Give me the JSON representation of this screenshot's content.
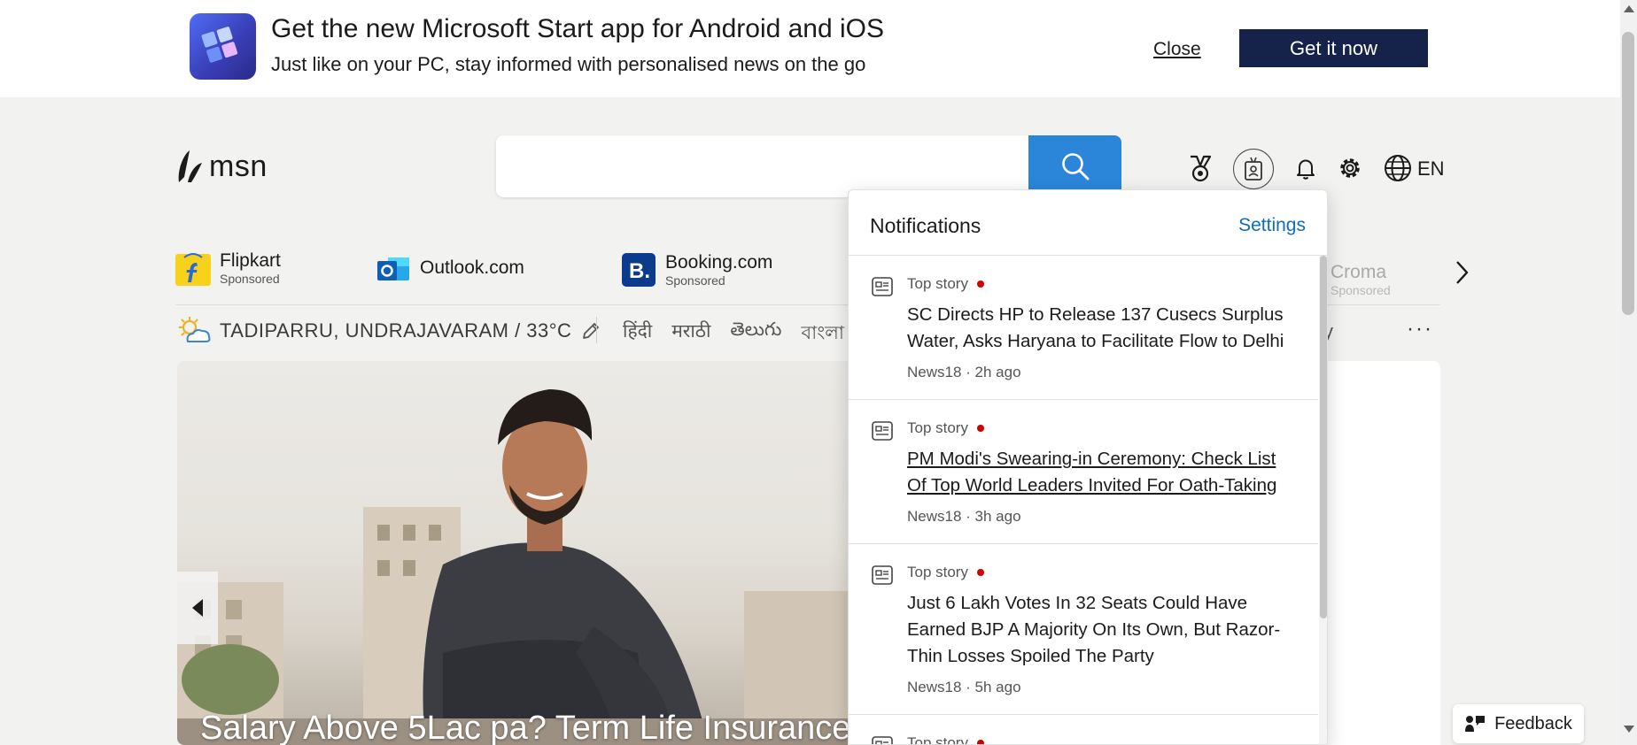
{
  "promo": {
    "title": "Get the new Microsoft Start app for Android and iOS",
    "subtitle": "Just like on your PC, stay informed with personalised news on the go",
    "close_label": "Close",
    "cta_label": "Get it now"
  },
  "header": {
    "logo_text": "msn",
    "search_placeholder": "",
    "language": "EN",
    "icons": [
      "rewards-icon",
      "profile-icon",
      "bell-icon",
      "gear-icon",
      "globe-icon",
      "search-icon"
    ]
  },
  "shortcuts": [
    {
      "label": "Flipkart",
      "sponsored": "Sponsored"
    },
    {
      "label": "Outlook.com",
      "sponsored": ""
    },
    {
      "label": "Booking.com",
      "sponsored": "Sponsored"
    },
    {
      "label": "Croma",
      "sponsored": "Sponsored"
    }
  ],
  "weather": {
    "location": "TADIPARRU, UNDRAJAVARAM / 33°C"
  },
  "languages": [
    "हिंदी",
    "मराठी",
    "తెలుగు",
    "বাংলা"
  ],
  "partial_text": "y",
  "more_label": "···",
  "hero": {
    "caption": "Salary Above 5Lac pa? Term Life Insurance"
  },
  "feedback": {
    "label": "Feedback"
  },
  "notifications": {
    "title": "Notifications",
    "settings_label": "Settings",
    "items": [
      {
        "category": "Top story",
        "headline": "SC Directs HP to Release 137 Cusecs Surplus Water, Asks Haryana to Facilitate Flow to Delhi",
        "meta": "News18 · 2h ago"
      },
      {
        "category": "Top story",
        "headline": "PM Modi's Swearing-in Ceremony: Check List Of Top World Leaders Invited For Oath-Taking",
        "meta": "News18 · 3h ago"
      },
      {
        "category": "Top story",
        "headline": "Just 6 Lakh Votes In 32 Seats Could Have Earned BJP A Majority On Its Own, But Razor-Thin Losses Spoiled The Party",
        "meta": "News18 · 5h ago"
      },
      {
        "category": "Top story",
        "headline": "",
        "meta": ""
      }
    ]
  },
  "colors": {
    "search_button": "#2b86da",
    "cta_background": "#15234a",
    "link_blue": "#0f6cbd",
    "unread_dot": "#d00000"
  }
}
